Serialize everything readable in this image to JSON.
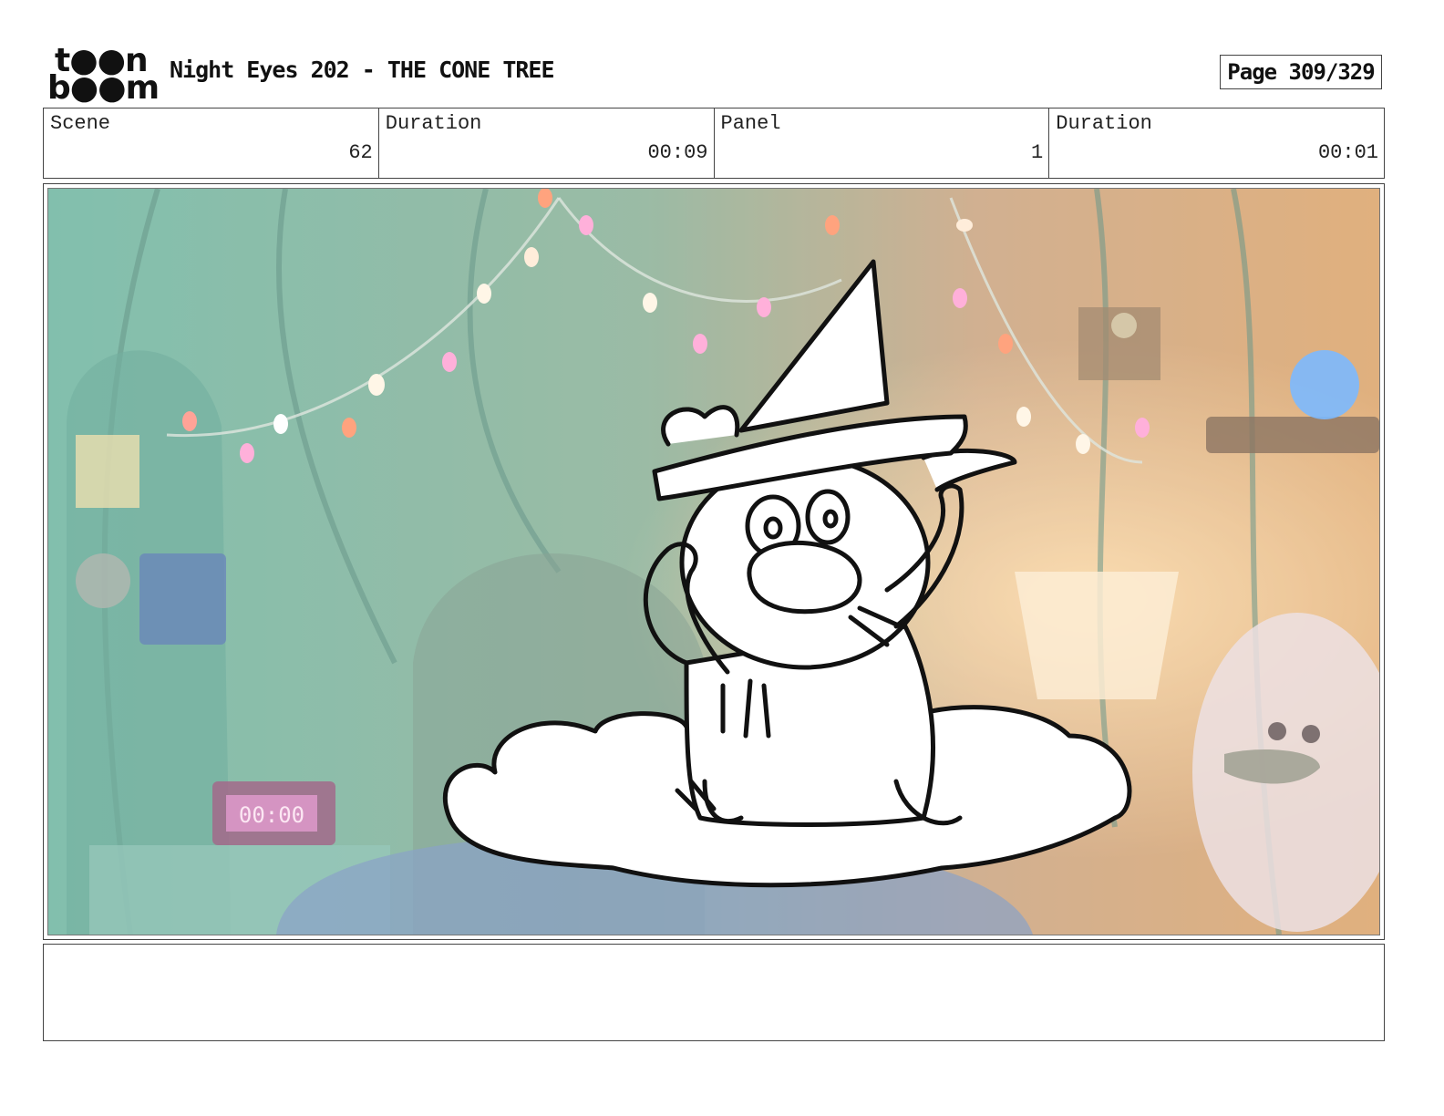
{
  "logo": {
    "line1": "t●●n",
    "line2": "b●●m"
  },
  "header": {
    "title": "Night Eyes 202 - THE CONE TREE",
    "page_label": "Page 309/329"
  },
  "info": {
    "scene_label": "Scene",
    "scene_value": "62",
    "scene_duration_label": "Duration",
    "scene_duration_value": "00:09",
    "panel_label": "Panel",
    "panel_value": "1",
    "panel_duration_label": "Duration",
    "panel_duration_value": "00:01"
  },
  "panel": {
    "clock_text": "00:00",
    "background_colors": {
      "left": "#5fae97",
      "center": "#8a9a7a",
      "right": "#d89a5a"
    }
  },
  "notes": {
    "text": ""
  }
}
